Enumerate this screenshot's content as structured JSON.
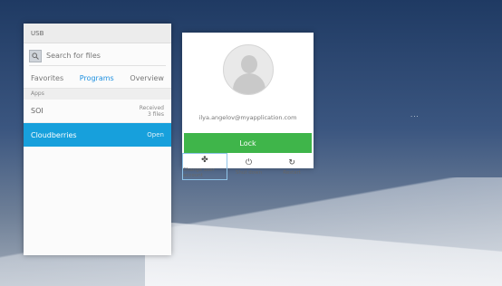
{
  "start_menu": {
    "top_text": "USB",
    "search_placeholder": "Search for files",
    "tabs": [
      "Favorites",
      "Programs",
      "Overview"
    ],
    "section_label": "Apps",
    "items": [
      {
        "label": "SOI",
        "meta_line1": "Received",
        "meta_line2": "3 files"
      },
      {
        "label": "Cloudberries",
        "meta": "Open"
      }
    ]
  },
  "lock_card": {
    "email": "ilya.angelov@myapplication.com",
    "action_label": "Lock",
    "actions": [
      {
        "icon": "user-lock-icon",
        "glyph": "✤",
        "label": "Change user account"
      },
      {
        "icon": "power-icon",
        "glyph": "⏻",
        "label": "Shut down"
      },
      {
        "icon": "restart-icon",
        "glyph": "↻",
        "label": "Restart"
      }
    ]
  },
  "desktop": {
    "dots": "..."
  },
  "colors": {
    "accent": "#17a0dc",
    "go": "#3fb54a"
  }
}
